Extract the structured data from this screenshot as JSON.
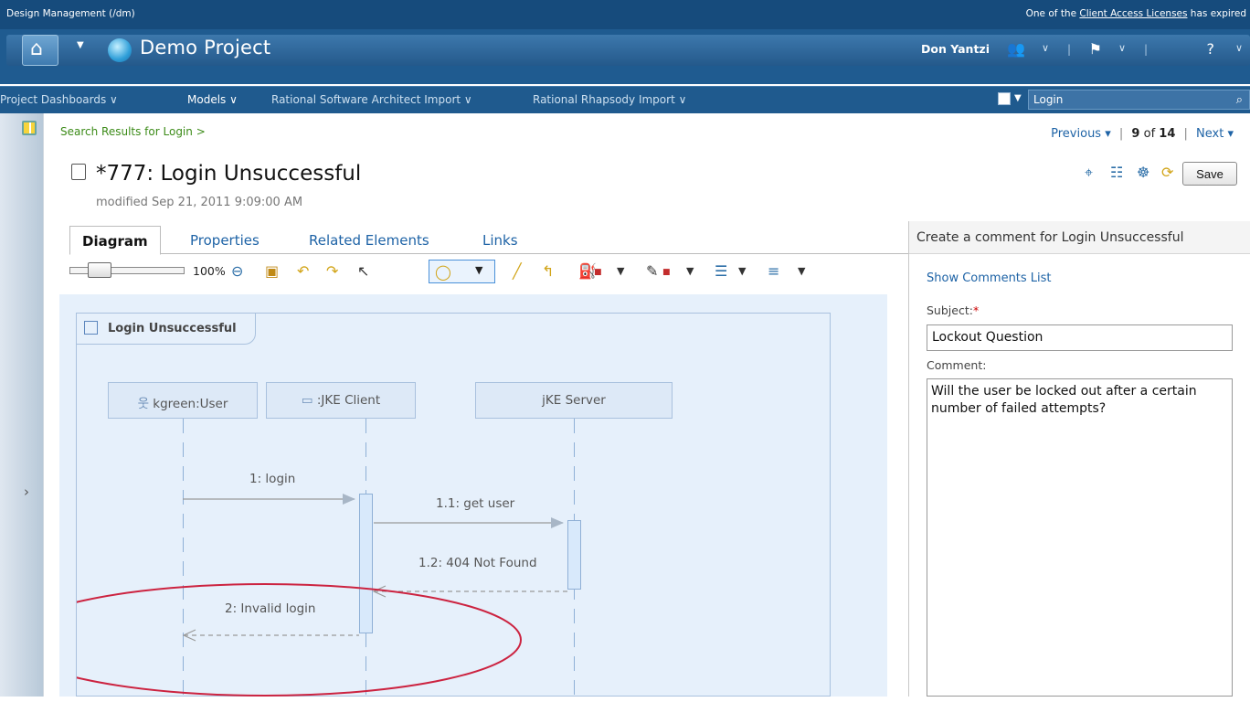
{
  "top": {
    "app": "Design Management (/dm)",
    "license_pre": "One of the ",
    "license_link": "Client Access Licenses",
    "license_post": " has expired"
  },
  "header": {
    "project": "Demo Project",
    "user": "Don Yantzi"
  },
  "nav": {
    "items": [
      "Project Dashboards ∨",
      "Models ∨",
      "Rational Software Architect Import ∨",
      "Rational Rhapsody Import ∨"
    ],
    "search": "Login"
  },
  "page": {
    "breadcrumb": "Search Results for Login >",
    "previous": "Previous ▾",
    "position": "9",
    "of": "of",
    "total": "14",
    "next": "Next ▾",
    "title": "*777: Login Unsuccessful",
    "modified": "modified Sep 21, 2011 9:09:00 AM",
    "save": "Save"
  },
  "tabs": [
    "Diagram",
    "Properties",
    "Related Elements",
    "Links"
  ],
  "toolbar": {
    "zoom": "100%"
  },
  "diagram": {
    "frame": "Login Unsuccessful",
    "lifelines": [
      "kgreen:User",
      ":JKE Client",
      "jKE Server"
    ],
    "messages": [
      "1: login",
      "1.1: get user",
      "1.2: 404 Not Found",
      "2: Invalid login"
    ]
  },
  "comment_panel": {
    "header": "Create a comment for Login Unsuccessful",
    "show": "Show Comments List",
    "subject_label": "Subject:",
    "required": "*",
    "subject": "Lockout Question",
    "comment_label": "Comment:",
    "comment": "Will the user be locked out after a certain number of failed attempts?"
  }
}
